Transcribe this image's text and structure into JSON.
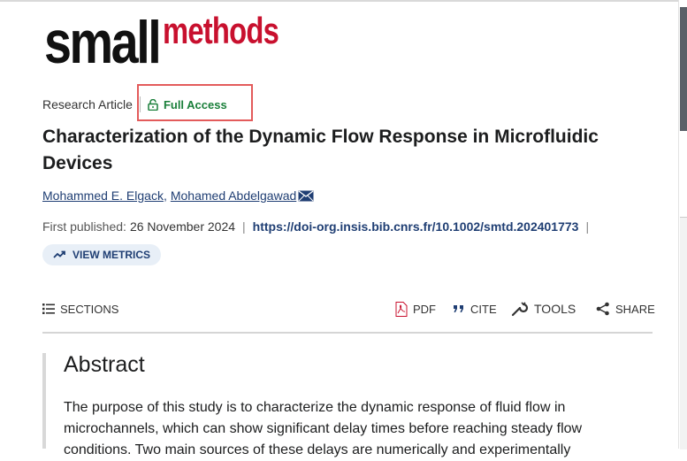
{
  "journal": {
    "logo_part1": "small",
    "logo_part2": "methods"
  },
  "article": {
    "type": "Research Article",
    "access": "Full Access",
    "title": "Characterization of the Dynamic Flow Response in Microfluidic Devices",
    "authors": [
      "Mohammed E. Elgack",
      "Mohamed Abdelgawad"
    ],
    "first_published_label": "First published:",
    "first_published_date": "26 November 2024",
    "doi": "https://doi-org.insis.bib.cnrs.fr/10.1002/smtd.202401773",
    "metrics_label": "VIEW METRICS"
  },
  "toolbar": {
    "sections": "SECTIONS",
    "pdf": "PDF",
    "cite": "CITE",
    "tools": "TOOLS",
    "share": "SHARE"
  },
  "abstract": {
    "heading": "Abstract",
    "text": "The purpose of this study is to characterize the dynamic response of fluid flow in microchannels, which can show significant delay times before reaching steady flow conditions. Two main sources of these delays are numerically and experimentally"
  },
  "colors": {
    "brand_red": "#c8102e",
    "link_blue": "#1f3e73",
    "access_green": "#1a7f3a",
    "highlight": "#e35b5b"
  }
}
